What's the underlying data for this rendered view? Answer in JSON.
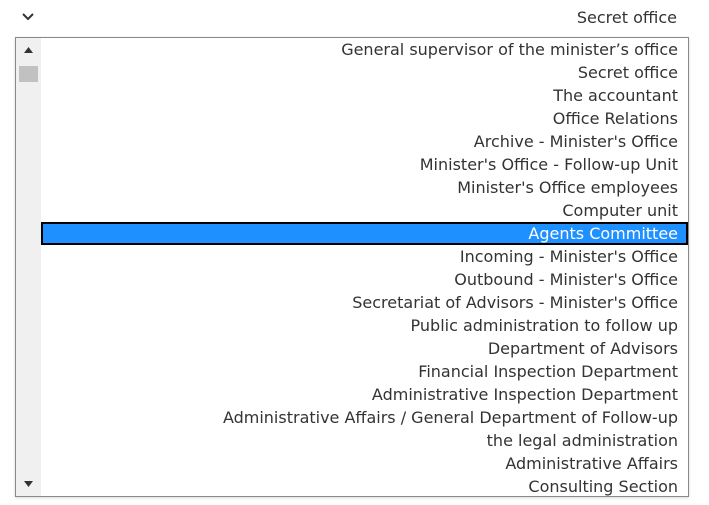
{
  "select": {
    "value": "Secret office"
  },
  "dropdown": {
    "selected_index": 8,
    "options": [
      "General supervisor of the minister’s office",
      "Secret office",
      "The accountant",
      "Office Relations",
      "Archive - Minister's Office",
      "Minister's Office - Follow-up Unit",
      "Minister's Office employees",
      "Computer unit",
      "Agents Committee",
      "Incoming - Minister's Office",
      "Outbound - Minister's Office",
      "Secretariat of Advisors - Minister's Office",
      "Public administration to follow up",
      "Department of Advisors",
      "Financial Inspection Department",
      "Administrative Inspection Department",
      "Administrative Affairs / General Department of Follow-up",
      "the legal administration",
      "Administrative Affairs",
      "Consulting Section"
    ]
  },
  "colors": {
    "highlight": "#1e90ff",
    "text": "#333333",
    "scrollbar_track": "#f0f0f0",
    "scrollbar_thumb": "#c1c1c1"
  },
  "icons": {
    "chevron": "chevron-down-icon",
    "scroll_up": "triangle-up-icon",
    "scroll_down": "triangle-down-icon"
  }
}
